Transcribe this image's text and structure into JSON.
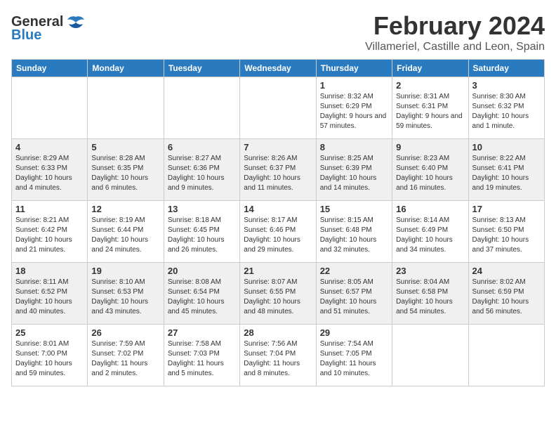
{
  "logo": {
    "general": "General",
    "blue": "Blue"
  },
  "header": {
    "month": "February 2024",
    "location": "Villameriel, Castille and Leon, Spain"
  },
  "weekdays": [
    "Sunday",
    "Monday",
    "Tuesday",
    "Wednesday",
    "Thursday",
    "Friday",
    "Saturday"
  ],
  "weeks": [
    [
      {
        "day": "",
        "info": ""
      },
      {
        "day": "",
        "info": ""
      },
      {
        "day": "",
        "info": ""
      },
      {
        "day": "",
        "info": ""
      },
      {
        "day": "1",
        "info": "Sunrise: 8:32 AM\nSunset: 6:29 PM\nDaylight: 9 hours and 57 minutes."
      },
      {
        "day": "2",
        "info": "Sunrise: 8:31 AM\nSunset: 6:31 PM\nDaylight: 9 hours and 59 minutes."
      },
      {
        "day": "3",
        "info": "Sunrise: 8:30 AM\nSunset: 6:32 PM\nDaylight: 10 hours and 1 minute."
      }
    ],
    [
      {
        "day": "4",
        "info": "Sunrise: 8:29 AM\nSunset: 6:33 PM\nDaylight: 10 hours and 4 minutes."
      },
      {
        "day": "5",
        "info": "Sunrise: 8:28 AM\nSunset: 6:35 PM\nDaylight: 10 hours and 6 minutes."
      },
      {
        "day": "6",
        "info": "Sunrise: 8:27 AM\nSunset: 6:36 PM\nDaylight: 10 hours and 9 minutes."
      },
      {
        "day": "7",
        "info": "Sunrise: 8:26 AM\nSunset: 6:37 PM\nDaylight: 10 hours and 11 minutes."
      },
      {
        "day": "8",
        "info": "Sunrise: 8:25 AM\nSunset: 6:39 PM\nDaylight: 10 hours and 14 minutes."
      },
      {
        "day": "9",
        "info": "Sunrise: 8:23 AM\nSunset: 6:40 PM\nDaylight: 10 hours and 16 minutes."
      },
      {
        "day": "10",
        "info": "Sunrise: 8:22 AM\nSunset: 6:41 PM\nDaylight: 10 hours and 19 minutes."
      }
    ],
    [
      {
        "day": "11",
        "info": "Sunrise: 8:21 AM\nSunset: 6:42 PM\nDaylight: 10 hours and 21 minutes."
      },
      {
        "day": "12",
        "info": "Sunrise: 8:19 AM\nSunset: 6:44 PM\nDaylight: 10 hours and 24 minutes."
      },
      {
        "day": "13",
        "info": "Sunrise: 8:18 AM\nSunset: 6:45 PM\nDaylight: 10 hours and 26 minutes."
      },
      {
        "day": "14",
        "info": "Sunrise: 8:17 AM\nSunset: 6:46 PM\nDaylight: 10 hours and 29 minutes."
      },
      {
        "day": "15",
        "info": "Sunrise: 8:15 AM\nSunset: 6:48 PM\nDaylight: 10 hours and 32 minutes."
      },
      {
        "day": "16",
        "info": "Sunrise: 8:14 AM\nSunset: 6:49 PM\nDaylight: 10 hours and 34 minutes."
      },
      {
        "day": "17",
        "info": "Sunrise: 8:13 AM\nSunset: 6:50 PM\nDaylight: 10 hours and 37 minutes."
      }
    ],
    [
      {
        "day": "18",
        "info": "Sunrise: 8:11 AM\nSunset: 6:52 PM\nDaylight: 10 hours and 40 minutes."
      },
      {
        "day": "19",
        "info": "Sunrise: 8:10 AM\nSunset: 6:53 PM\nDaylight: 10 hours and 43 minutes."
      },
      {
        "day": "20",
        "info": "Sunrise: 8:08 AM\nSunset: 6:54 PM\nDaylight: 10 hours and 45 minutes."
      },
      {
        "day": "21",
        "info": "Sunrise: 8:07 AM\nSunset: 6:55 PM\nDaylight: 10 hours and 48 minutes."
      },
      {
        "day": "22",
        "info": "Sunrise: 8:05 AM\nSunset: 6:57 PM\nDaylight: 10 hours and 51 minutes."
      },
      {
        "day": "23",
        "info": "Sunrise: 8:04 AM\nSunset: 6:58 PM\nDaylight: 10 hours and 54 minutes."
      },
      {
        "day": "24",
        "info": "Sunrise: 8:02 AM\nSunset: 6:59 PM\nDaylight: 10 hours and 56 minutes."
      }
    ],
    [
      {
        "day": "25",
        "info": "Sunrise: 8:01 AM\nSunset: 7:00 PM\nDaylight: 10 hours and 59 minutes."
      },
      {
        "day": "26",
        "info": "Sunrise: 7:59 AM\nSunset: 7:02 PM\nDaylight: 11 hours and 2 minutes."
      },
      {
        "day": "27",
        "info": "Sunrise: 7:58 AM\nSunset: 7:03 PM\nDaylight: 11 hours and 5 minutes."
      },
      {
        "day": "28",
        "info": "Sunrise: 7:56 AM\nSunset: 7:04 PM\nDaylight: 11 hours and 8 minutes."
      },
      {
        "day": "29",
        "info": "Sunrise: 7:54 AM\nSunset: 7:05 PM\nDaylight: 11 hours and 10 minutes."
      },
      {
        "day": "",
        "info": ""
      },
      {
        "day": "",
        "info": ""
      }
    ]
  ]
}
